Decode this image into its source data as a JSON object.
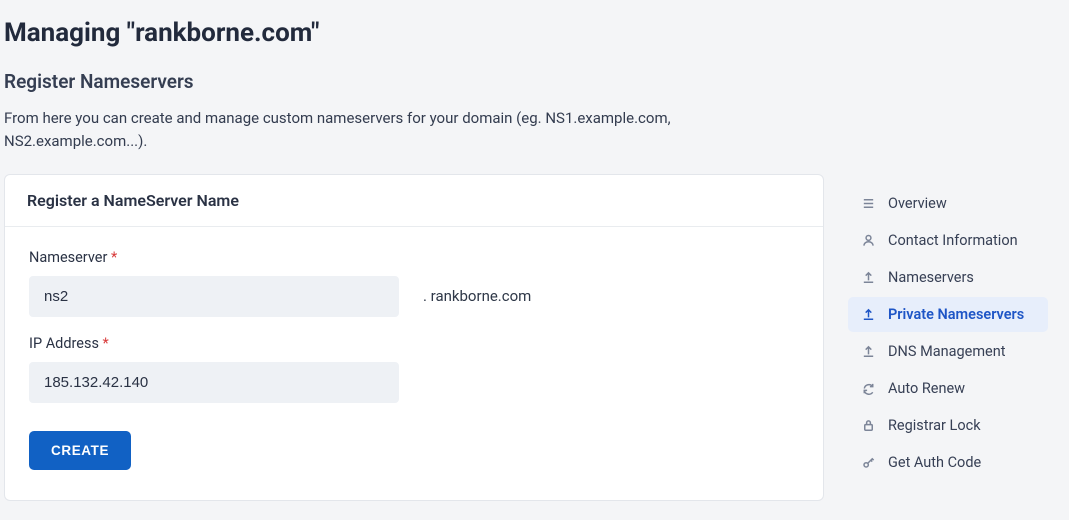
{
  "page_title": "Managing \"rankborne.com\"",
  "section_title": "Register Nameservers",
  "section_desc": "From here you can create and manage custom nameservers for your domain (eg. NS1.example.com, NS2.example.com...).",
  "card": {
    "header": "Register a NameServer Name",
    "ns_label": "Nameserver",
    "ns_value": "ns2",
    "ns_suffix": ". rankborne.com",
    "ip_label": "IP Address",
    "ip_value": "185.132.42.140",
    "submit": "CREATE",
    "required_marker": "*"
  },
  "sidebar": {
    "items": [
      {
        "label": "Overview",
        "icon": "list-icon"
      },
      {
        "label": "Contact Information",
        "icon": "user-icon"
      },
      {
        "label": "Nameservers",
        "icon": "upload-icon"
      },
      {
        "label": "Private Nameservers",
        "icon": "upload-icon",
        "active": true
      },
      {
        "label": "DNS Management",
        "icon": "upload-icon"
      },
      {
        "label": "Auto Renew",
        "icon": "refresh-icon"
      },
      {
        "label": "Registrar Lock",
        "icon": "lock-icon"
      },
      {
        "label": "Get Auth Code",
        "icon": "key-icon"
      }
    ]
  }
}
